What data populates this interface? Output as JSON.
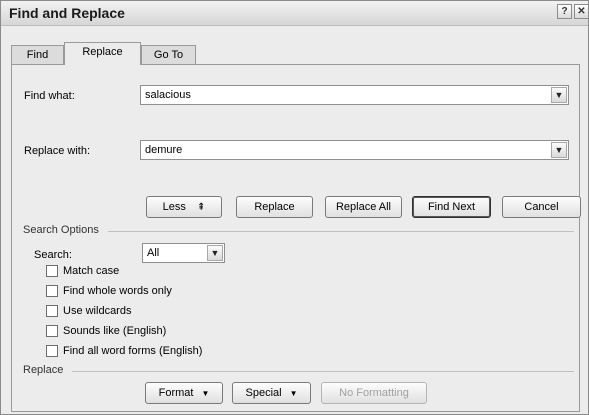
{
  "window": {
    "title": "Find and Replace",
    "help_glyph": "?",
    "close_glyph": "✕"
  },
  "tabs": [
    {
      "label": "Find"
    },
    {
      "label": "Replace"
    },
    {
      "label": "Go To"
    }
  ],
  "find": {
    "label": "Find what:",
    "value": "salacious"
  },
  "replace": {
    "label": "Replace with:",
    "value": "demure"
  },
  "buttons": {
    "less": "Less",
    "less_glyph": "⇞",
    "replace": "Replace",
    "replace_all": "Replace All",
    "find_next": "Find Next",
    "cancel": "Cancel"
  },
  "search_options": {
    "title": "Search Options",
    "search_label": "Search:",
    "search_value": "All",
    "checkboxes": [
      {
        "label": "Match case",
        "checked": false
      },
      {
        "label": "Find whole words only",
        "checked": false
      },
      {
        "label": "Use wildcards",
        "checked": false
      },
      {
        "label": "Sounds like (English)",
        "checked": false
      },
      {
        "label": "Find all word forms (English)",
        "checked": false
      }
    ]
  },
  "replace_section": {
    "title": "Replace",
    "format": "Format",
    "special": "Special",
    "no_formatting": "No Formatting"
  },
  "icons": {
    "dropdown": "chevron-down-icon",
    "help": "help-icon",
    "close": "close-icon"
  }
}
